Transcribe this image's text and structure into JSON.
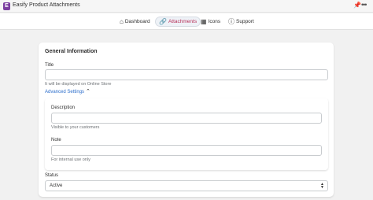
{
  "window": {
    "title": "Easify Product Attachments",
    "logo_letter": "E"
  },
  "nav": {
    "items": [
      {
        "id": "dashboard",
        "label": "Dashboard",
        "icon": "home-icon"
      },
      {
        "id": "attachments",
        "label": "Attachments",
        "icon": "paperclip-icon",
        "active": true
      },
      {
        "id": "icons",
        "label": "Icons",
        "icon": "icons-icon"
      },
      {
        "id": "support",
        "label": "Support",
        "icon": "help-icon"
      }
    ]
  },
  "form": {
    "section_title": "General Information",
    "title_label": "Title",
    "title_value": "",
    "title_help": "It will be displayed on Online Store",
    "advanced_toggle": "Advanced Settings",
    "description_label": "Description",
    "description_value": "",
    "description_help": "Visible to your customers",
    "note_label": "Note",
    "note_value": "",
    "note_help": "For internal use only",
    "status_label": "Status",
    "status_value": "Active"
  },
  "colors": {
    "accent": "#b8325a",
    "link": "#2c6ecb",
    "logo": "#7b3fa0"
  }
}
